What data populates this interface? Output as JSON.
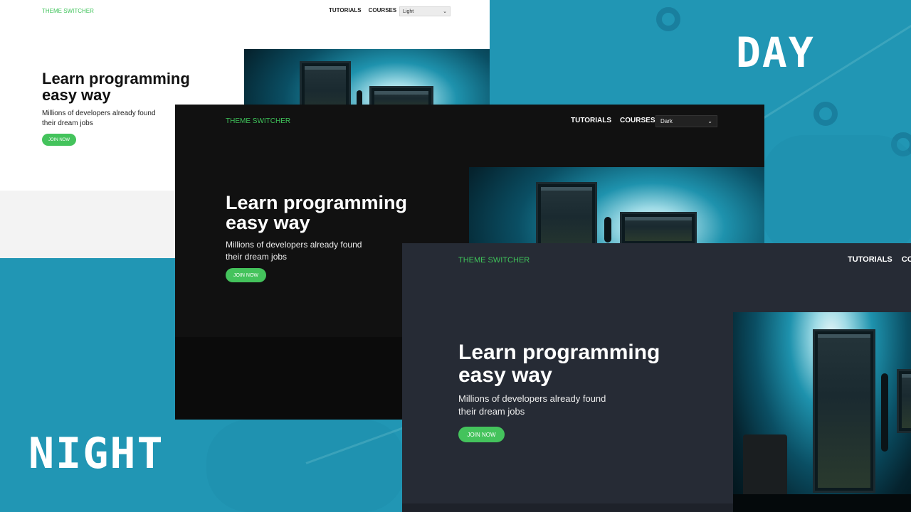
{
  "labels": {
    "day": "DAY",
    "night": "NIGHT"
  },
  "theme": {
    "light": {
      "brand": "THEME SWITCHER",
      "nav": [
        "TUTORIALS",
        "COURSES"
      ],
      "select_value": "Light",
      "title_line1": "Learn programming",
      "title_line2": "easy way",
      "sub_line1": "Millions of developers already found",
      "sub_line2": "their dream jobs",
      "cta": "JOIN NOW"
    },
    "dark": {
      "brand": "THEME SWITCHER",
      "nav": [
        "TUTORIALS",
        "COURSES"
      ],
      "select_value": "Dark",
      "title_line1": "Learn programming",
      "title_line2": "easy way",
      "sub_line1": "Millions of developers already found",
      "sub_line2": "their dream jobs",
      "cta": "JOIN NOW"
    },
    "slate": {
      "brand": "THEME SWITCHER",
      "nav": [
        "TUTORIALS",
        "COU"
      ],
      "title_line1": "Learn programming",
      "title_line2": "easy way",
      "sub_line1": "Millions of developers already found",
      "sub_line2": "their dream jobs",
      "cta": "JOIN NOW"
    }
  },
  "colors": {
    "background": "#2196b4",
    "accent": "#44c35c",
    "light_bg": "#ffffff",
    "dark_bg": "#111111",
    "slate_bg": "#262b35"
  },
  "icons": {
    "select_caret": "chevron-down-icon"
  }
}
